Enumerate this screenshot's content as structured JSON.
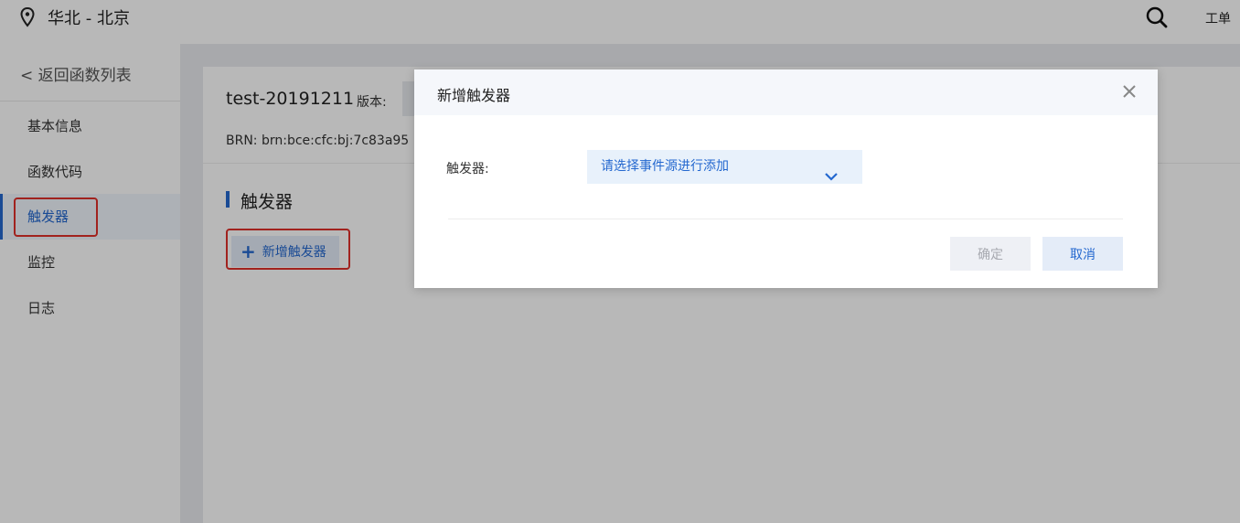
{
  "topbar": {
    "region": "华北 - 北京",
    "search_icon": "search-icon",
    "ticket_label": "工单"
  },
  "sidebar": {
    "back_label": "< 返回函数列表",
    "items": [
      {
        "label": "基本信息",
        "active": false
      },
      {
        "label": "函数代码",
        "active": false
      },
      {
        "label": "触发器",
        "active": true
      },
      {
        "label": "监控",
        "active": false
      },
      {
        "label": "日志",
        "active": false
      }
    ]
  },
  "main": {
    "function_name": "test-20191211",
    "version_label": "版本:",
    "brn": "BRN: brn:bce:cfc:bj:7c83a95",
    "section_title": "触发器",
    "add_trigger_button": "新增触发器"
  },
  "modal": {
    "title": "新增触发器",
    "field_label": "触发器:",
    "select_placeholder": "请选择事件源进行添加",
    "confirm_button": "确定",
    "cancel_button": "取消"
  },
  "colors": {
    "accent": "#2468cf",
    "highlight_border": "#e0302a",
    "overlay": "rgba(0,0,0,0.28)"
  }
}
